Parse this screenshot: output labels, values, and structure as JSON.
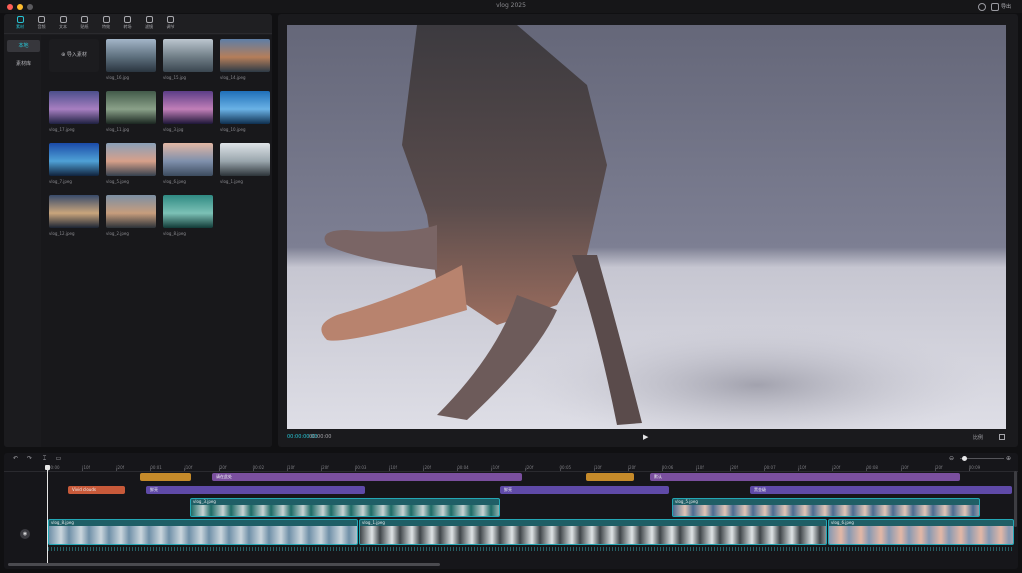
{
  "window": {
    "title": "vlog 2025",
    "right_buttons": [
      "",
      "导出"
    ]
  },
  "toolbar": {
    "items": [
      {
        "label": "素材",
        "icon": "media-icon",
        "active": true
      },
      {
        "label": "音频",
        "icon": "audio-icon",
        "active": false
      },
      {
        "label": "文本",
        "icon": "text-icon",
        "active": false
      },
      {
        "label": "贴纸",
        "icon": "sticker-icon",
        "active": false
      },
      {
        "label": "特效",
        "icon": "effects-icon",
        "active": false
      },
      {
        "label": "转场",
        "icon": "transition-icon",
        "active": false
      },
      {
        "label": "滤镜",
        "icon": "filter-icon",
        "active": false
      },
      {
        "label": "调节",
        "icon": "adjust-icon",
        "active": false
      }
    ]
  },
  "sidenav": {
    "items": [
      {
        "label": "本地",
        "active": true
      },
      {
        "label": "素材库",
        "active": false
      }
    ]
  },
  "media": {
    "import_label": "导入素材",
    "thumbs": [
      {
        "name": "vlog_16.jpg",
        "duration": "",
        "colors": [
          "#a3b5c8",
          "#5d6f7d",
          "#2a3540"
        ]
      },
      {
        "name": "vlog_15.jpg",
        "duration": "",
        "colors": [
          "#bcc6cf",
          "#6f7d86",
          "#3a4650"
        ]
      },
      {
        "name": "vlog_14.jpeg",
        "duration": "",
        "colors": [
          "#5e7ea6",
          "#b57e5a",
          "#2d3a46"
        ]
      },
      {
        "name": "vlog_17.jpeg",
        "duration": "",
        "colors": [
          "#4b4f8c",
          "#a77fc1",
          "#1f2142"
        ]
      },
      {
        "name": "vlog_11.jpg",
        "duration": "",
        "colors": [
          "#425a4a",
          "#8aa189",
          "#1a2620"
        ]
      },
      {
        "name": "vlog_3.jpg",
        "duration": "",
        "colors": [
          "#5b3d87",
          "#c17fb8",
          "#1d1638"
        ]
      },
      {
        "name": "vlog_10.jpeg",
        "duration": "",
        "colors": [
          "#1f6fb8",
          "#6ab2e6",
          "#0e2f4f"
        ]
      },
      {
        "name": "vlog_7.jpeg",
        "duration": "",
        "colors": [
          "#1b4aa8",
          "#4fa1d6",
          "#10223c"
        ]
      },
      {
        "name": "vlog_5.jpeg",
        "duration": "",
        "colors": [
          "#8aa0b8",
          "#d7a08a",
          "#34404e"
        ]
      },
      {
        "name": "vlog_6.jpeg",
        "duration": "",
        "colors": [
          "#e3b7a4",
          "#7f90ac",
          "#3c4b5e"
        ]
      },
      {
        "name": "vlog_1.jpeg",
        "duration": "",
        "colors": [
          "#dfe4e8",
          "#9aa6ad",
          "#2c3338"
        ]
      },
      {
        "name": "vlog_12.jpeg",
        "duration": "",
        "colors": [
          "#384a6a",
          "#c9a57c",
          "#1b2434"
        ]
      },
      {
        "name": "vlog_2.jpeg",
        "duration": "",
        "colors": [
          "#7c8fa3",
          "#c79d7d",
          "#2b3138"
        ]
      },
      {
        "name": "vlog_8.jpeg",
        "duration": "",
        "colors": [
          "#2f8a83",
          "#7cc1b6",
          "#113a37"
        ]
      }
    ]
  },
  "player": {
    "current_time": "00:00:00:00",
    "total_time": "00:00:00",
    "ratio_label": "比例"
  },
  "timeline": {
    "ruler": [
      "00:00",
      "|10f",
      "|20f",
      "00:01",
      "|10f",
      "|20f",
      "00:02",
      "|10f",
      "|20f",
      "00:03",
      "|10f",
      "|20f",
      "00:04",
      "|10f",
      "|20f",
      "00:05",
      "|10f",
      "|20f",
      "00:06",
      "|10f",
      "|20f",
      "00:07",
      "|10f",
      "|20f",
      "00:08",
      "|10f",
      "|20f",
      "00:09"
    ],
    "row1": [
      {
        "label": "",
        "color": "#c58a2a"
      },
      {
        "label": "请在此处",
        "color": "#7a4f9e"
      },
      {
        "label": "",
        "color": "#c58a2a"
      },
      {
        "label": "默认",
        "color": "#7a4f9e"
      }
    ],
    "row2": [
      {
        "label": "Vivid clouds",
        "color": "#c85a3a"
      },
      {
        "label": "鲜亮",
        "color": "#5f4aa8"
      },
      {
        "label": "鲜亮",
        "color": "#5f4aa8"
      },
      {
        "label": "黑金级",
        "color": "#5f4aa8"
      }
    ],
    "row3": [
      {
        "label": "vlog_3.jpeg"
      },
      {
        "label": "vlog_5.jpeg"
      }
    ],
    "main": [
      {
        "label": "vlog_8.jpeg"
      },
      {
        "label": "vlog_1.jpeg"
      },
      {
        "label": "vlog_6.jpeg"
      }
    ]
  }
}
